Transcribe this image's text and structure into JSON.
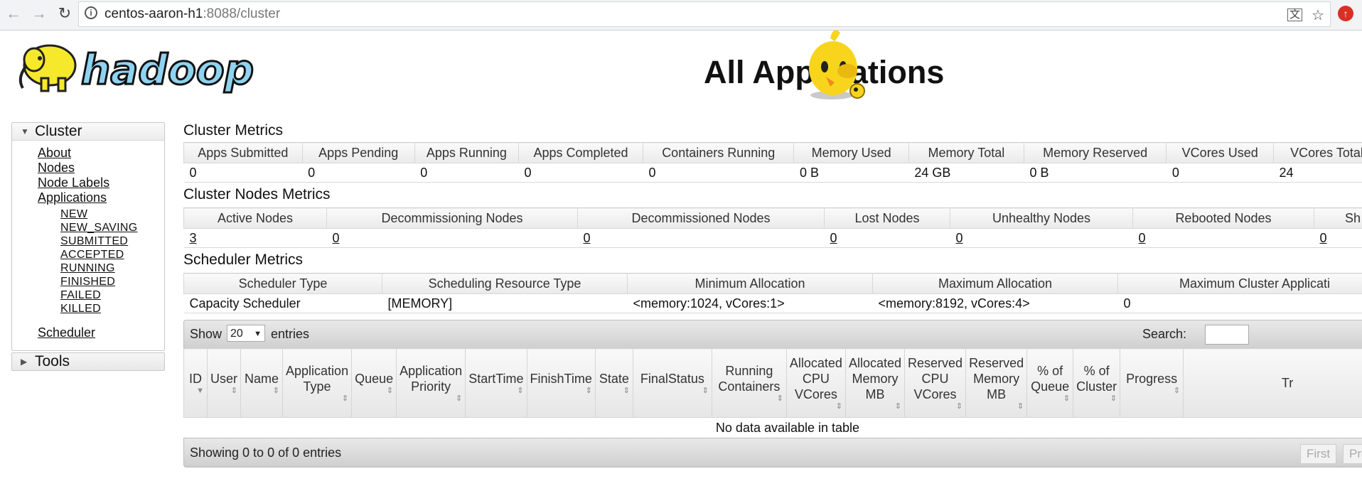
{
  "browser": {
    "url_host": "centos-aaron-h1",
    "url_rest": ":8088/cluster",
    "back_icon": "←",
    "forward_icon": "→",
    "reload_icon": "↻",
    "translate_icon": "文",
    "star_icon": "☆",
    "ext_icon": "↑"
  },
  "header": {
    "logo_text": "hadoop",
    "page_title": "All Applications"
  },
  "sidebar": {
    "cluster_label": "Cluster",
    "links": [
      "About",
      "Nodes",
      "Node Labels",
      "Applications"
    ],
    "app_states": [
      "NEW",
      "NEW_SAVING",
      "SUBMITTED",
      "ACCEPTED",
      "RUNNING",
      "FINISHED",
      "FAILED",
      "KILLED"
    ],
    "scheduler_label": "Scheduler",
    "tools_label": "Tools"
  },
  "cluster_metrics": {
    "title": "Cluster Metrics",
    "headers": [
      "Apps Submitted",
      "Apps Pending",
      "Apps Running",
      "Apps Completed",
      "Containers Running",
      "Memory Used",
      "Memory Total",
      "Memory Reserved",
      "VCores Used",
      "VCores Total"
    ],
    "values": [
      "0",
      "0",
      "0",
      "0",
      "0",
      "0 B",
      "24 GB",
      "0 B",
      "0",
      "24"
    ]
  },
  "node_metrics": {
    "title": "Cluster Nodes Metrics",
    "headers": [
      "Active Nodes",
      "Decommissioning Nodes",
      "Decommissioned Nodes",
      "Lost Nodes",
      "Unhealthy Nodes",
      "Rebooted Nodes",
      "Sh"
    ],
    "values": [
      "3",
      "0",
      "0",
      "0",
      "0",
      "0",
      "0"
    ]
  },
  "scheduler_metrics": {
    "title": "Scheduler Metrics",
    "headers": [
      "Scheduler Type",
      "Scheduling Resource Type",
      "Minimum Allocation",
      "Maximum Allocation",
      "Maximum Cluster Applicati"
    ],
    "values": [
      "Capacity Scheduler",
      "[MEMORY]",
      "<memory:1024, vCores:1>",
      "<memory:8192, vCores:4>",
      "0"
    ]
  },
  "apps_table": {
    "show_label": "Show",
    "length_value": "20",
    "entries_label": "entries",
    "search_label": "Search:",
    "headers": [
      "ID",
      "User",
      "Name",
      "Application Type",
      "Queue",
      "Application Priority",
      "StartTime",
      "FinishTime",
      "State",
      "FinalStatus",
      "Running Containers",
      "Allocated CPU VCores",
      "Allocated Memory MB",
      "Reserved CPU VCores",
      "Reserved Memory MB",
      "% of Queue",
      "% of Cluster",
      "Progress",
      "Tr"
    ],
    "empty_text": "No data available in table",
    "info_text": "Showing 0 to 0 of 0 entries",
    "first_label": "First",
    "prev_label": "Pre"
  }
}
